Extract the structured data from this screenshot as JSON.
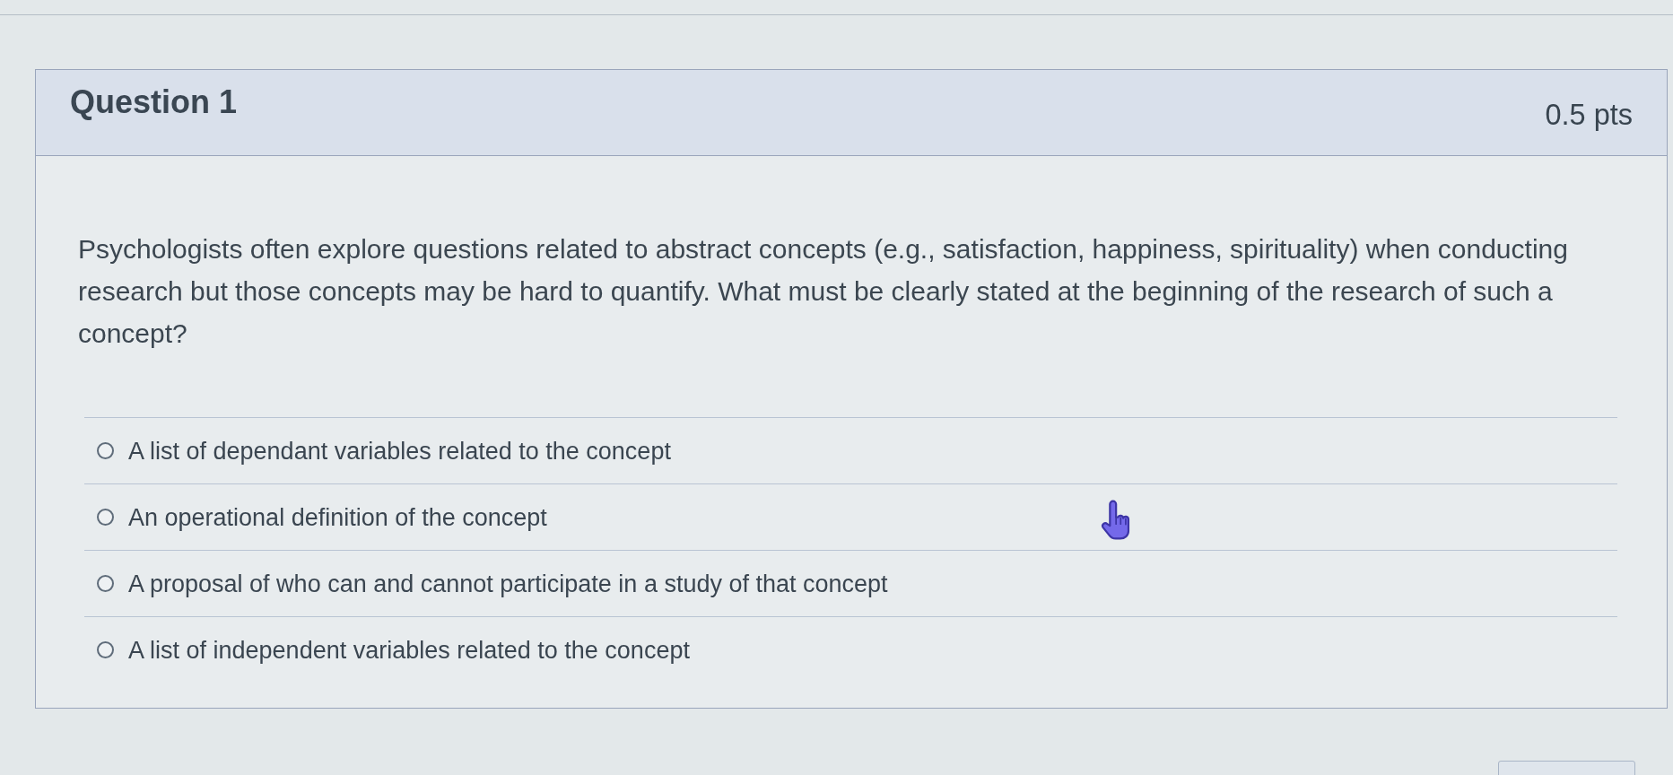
{
  "question": {
    "title": "Question 1",
    "points": "0.5 pts",
    "text": "Psychologists often explore questions related to abstract concepts (e.g., satisfaction, happiness, spirituality) when conducting research but those concepts may be hard to quantify. What must be clearly stated at the beginning of the research of such a concept?",
    "answers": [
      {
        "label": "A list of dependant variables related to the concept",
        "selected": false
      },
      {
        "label": "An operational definition of the concept",
        "selected": false
      },
      {
        "label": "A proposal of who can and cannot participate in a study of that concept",
        "selected": false
      },
      {
        "label": "A list of independent variables related to the concept",
        "selected": false
      }
    ]
  }
}
